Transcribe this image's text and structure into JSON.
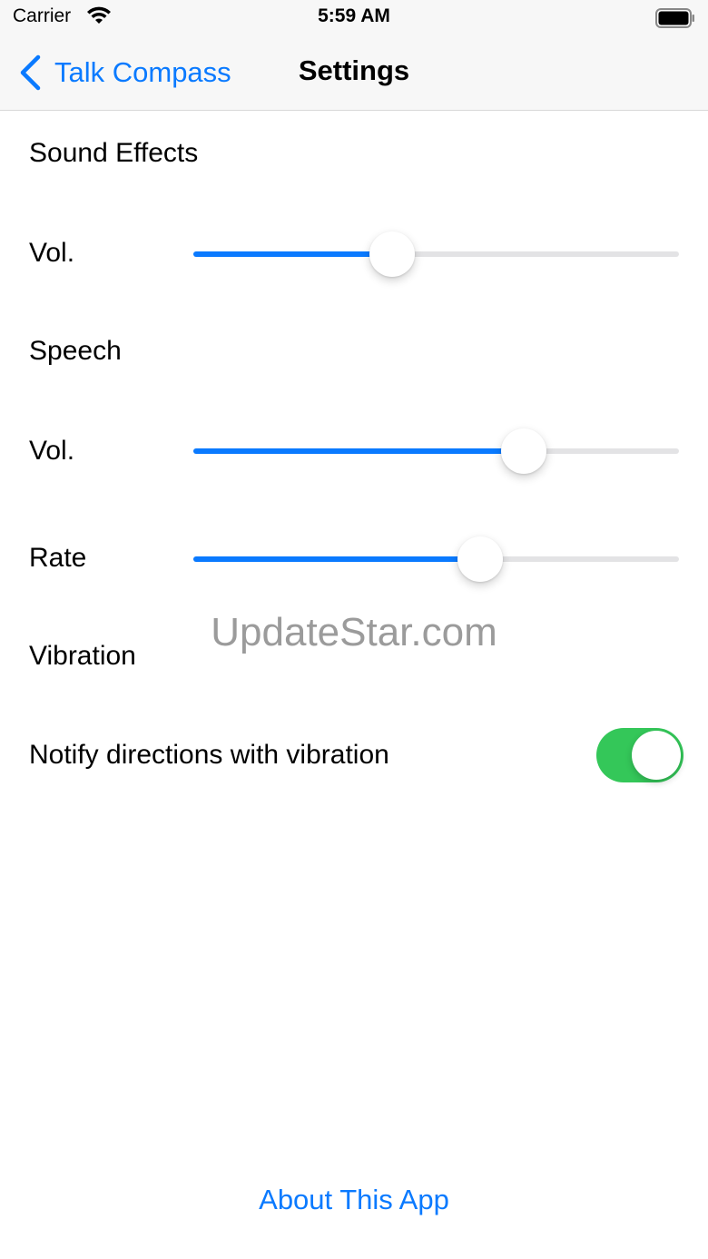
{
  "status_bar": {
    "carrier": "Carrier",
    "time": "5:59 AM",
    "wifi_icon": "wifi-icon",
    "battery_icon": "battery-icon"
  },
  "nav": {
    "back_label": "Talk Compass",
    "title": "Settings",
    "back_icon": "chevron-left-icon"
  },
  "sound_effects": {
    "header": "Sound Effects",
    "volume": {
      "label": "Vol.",
      "value": 0.41
    }
  },
  "speech": {
    "header": "Speech",
    "volume": {
      "label": "Vol.",
      "value": 0.68
    },
    "rate": {
      "label": "Rate",
      "value": 0.59
    }
  },
  "vibration": {
    "header": "Vibration",
    "notify_label": "Notify directions with vibration",
    "notify_enabled": true
  },
  "watermark": "UpdateStar.com",
  "about_link": "About This App",
  "colors": {
    "accent": "#0a7aff",
    "toggle_on": "#34c759",
    "track": "#e3e3e5"
  }
}
